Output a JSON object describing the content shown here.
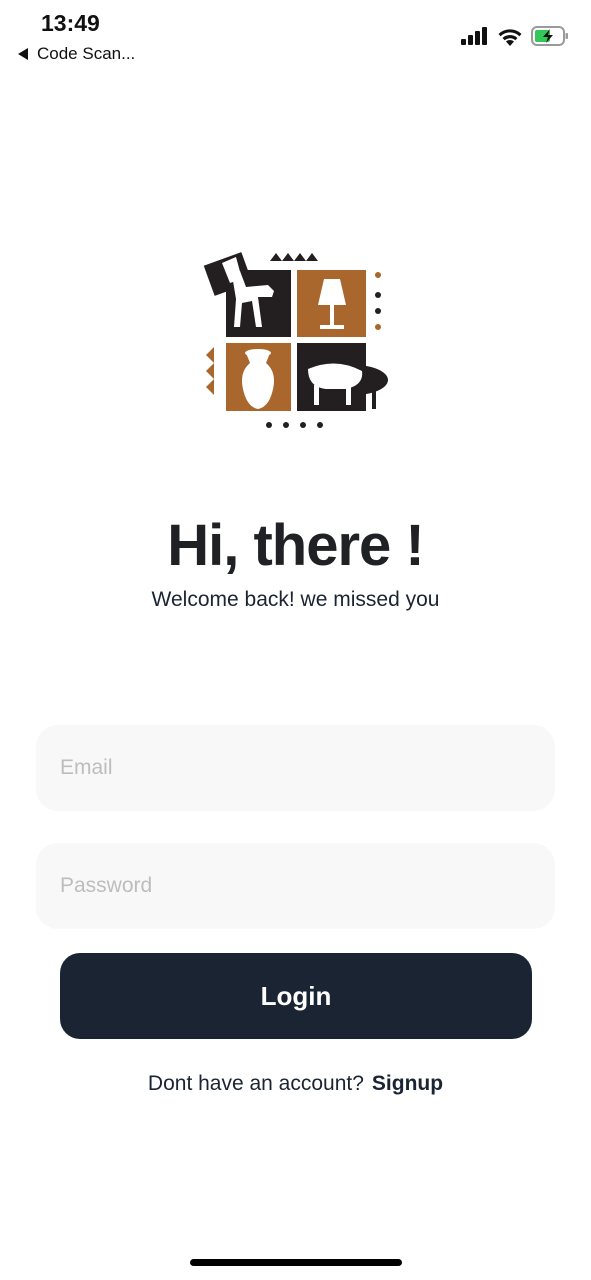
{
  "status_bar": {
    "time": "13:49",
    "back_label": "Code Scan...",
    "icons": [
      "cellular-signal-icon",
      "wifi-icon",
      "battery-charging-icon"
    ]
  },
  "logo": {
    "name": "furniture-logo",
    "colors": {
      "dark": "#231f20",
      "brown": "#a9672d"
    }
  },
  "greeting": {
    "title": "Hi, there !",
    "subtitle": "Welcome back! we missed you"
  },
  "form": {
    "email_placeholder": "Email",
    "password_placeholder": "Password",
    "login_label": "Login"
  },
  "footer": {
    "prompt": "Dont have an account?",
    "signup_label": "Signup"
  },
  "colors": {
    "primary": "#1a2433",
    "field_bg": "#f8f8f8",
    "placeholder": "#bdbdbd"
  }
}
